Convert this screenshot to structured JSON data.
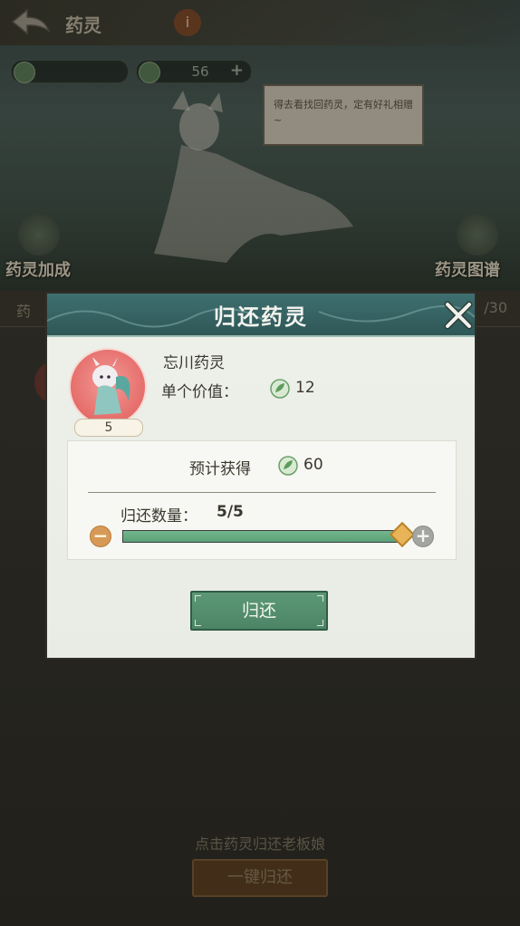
{
  "header": {
    "title": "药灵",
    "info_badge": "i"
  },
  "resources": {
    "secondary_value": "56",
    "plus": "+"
  },
  "scene": {
    "speech": "得去看找回药灵，定有好礼相赠~",
    "left_label": "药灵加成",
    "right_label": "药灵图谱"
  },
  "list": {
    "left_label": "药",
    "right_label": "/30"
  },
  "modal": {
    "title": "归还药灵",
    "close_icon": "close-icon",
    "spirit": {
      "name": "忘川药灵",
      "count": "5",
      "unit_value_label": "单个价值：",
      "unit_value": "12"
    },
    "expected": {
      "label": "预计获得",
      "value": "60"
    },
    "quantity": {
      "label": "归还数量：",
      "value": "5/5",
      "current": 5,
      "max": 5,
      "minus": "−",
      "plus": "+"
    },
    "return_button": "归还",
    "colors": {
      "header": "#3f6f70",
      "accent_green": "#5aa077",
      "button_green": "#4c8566",
      "minus_orange": "#d79a56"
    }
  },
  "footer": {
    "hint": "点击药灵归还老板娘",
    "return_all_button": "一键归还"
  }
}
